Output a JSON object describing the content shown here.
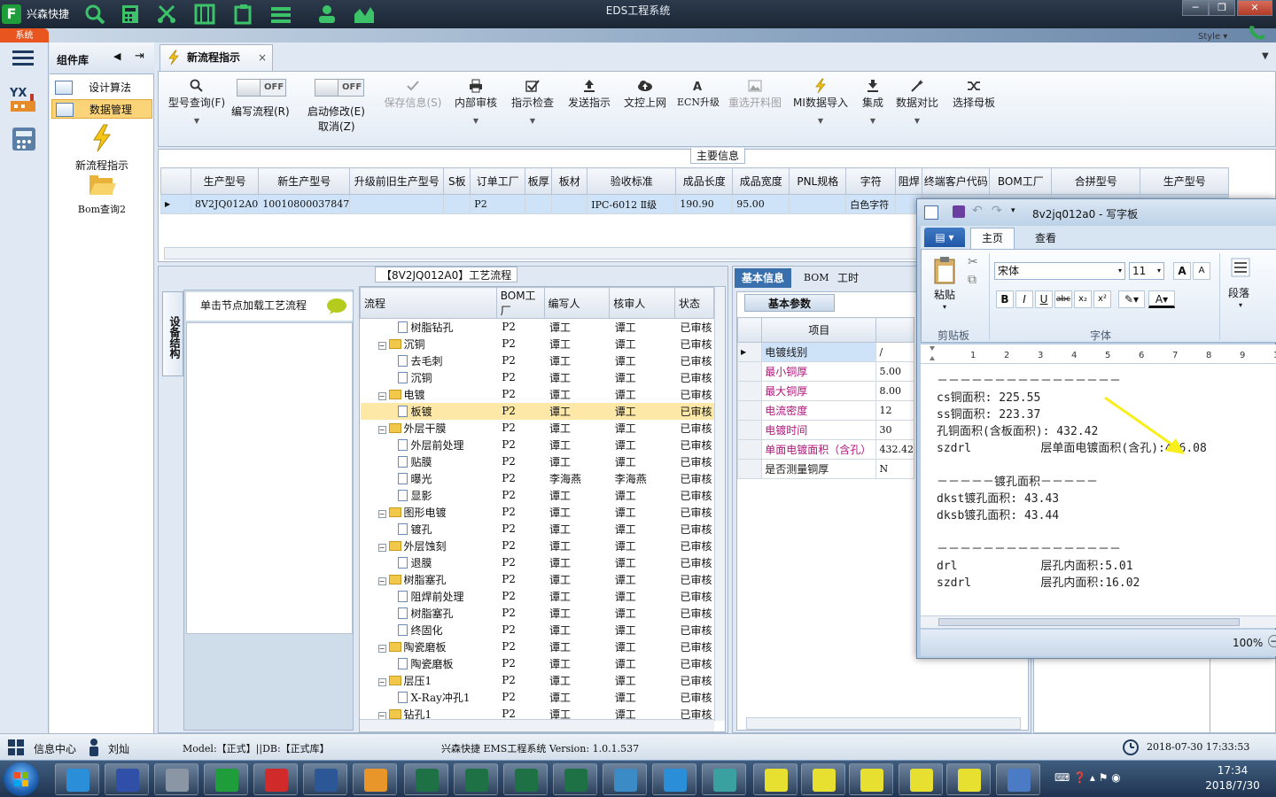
{
  "app": {
    "logo": "F",
    "name": "兴森快捷",
    "window_title": "EDS工程系统",
    "style_label": "Style",
    "system_tab": "系统"
  },
  "sidebar": {
    "header": "组件库",
    "items": [
      {
        "label": "设计算法"
      },
      {
        "label": "数据管理"
      }
    ],
    "big_items": [
      {
        "label": "新流程指示"
      },
      {
        "label": "Bom查询2"
      }
    ]
  },
  "doc_tab": {
    "label": "新流程指示"
  },
  "toolbar": {
    "buttons": [
      {
        "label": "型号查询(F)",
        "icon": "search-icon"
      },
      {
        "label": "保存信息(S)",
        "icon": "check-icon"
      },
      {
        "label": "内部审核",
        "icon": "printer-icon"
      },
      {
        "label": "指示检查",
        "icon": "checkbox-icon"
      },
      {
        "label": "发送指示",
        "icon": "upload-icon"
      },
      {
        "label": "文控上网",
        "icon": "cloud-upload-icon"
      },
      {
        "label": "ECN升级",
        "icon": "ecn-icon"
      },
      {
        "label": "重选开料图",
        "icon": "image-icon"
      },
      {
        "label": "MI数据导入",
        "icon": "lightning-icon"
      },
      {
        "label": "集成",
        "icon": "download-icon"
      },
      {
        "label": "数据对比",
        "icon": "wand-icon"
      },
      {
        "label": "选择母板",
        "icon": "shuffle-icon"
      }
    ],
    "toggle1": {
      "state": "OFF",
      "label": "编写流程(R)"
    },
    "toggle2": {
      "state": "OFF",
      "label": "启动修改(E)",
      "sub": "取消(Z)"
    }
  },
  "main_info": {
    "title": "主要信息",
    "columns": [
      "生产型号",
      "新生产型号",
      "升级前旧生产型号",
      "S板",
      "订单工厂",
      "板厚",
      "板材",
      "验收标准",
      "成品长度",
      "成品宽度",
      "PNL规格",
      "字符",
      "阻焊",
      "终端客户代码",
      "BOM工厂",
      "合拼型号",
      "生产型号"
    ],
    "row": [
      "8V2JQ012A0",
      "10010800037847",
      "",
      "",
      "P2",
      "",
      "",
      "IPC-6012 Ⅱ级",
      "190.90",
      "95.00",
      "",
      "白色字符",
      "",
      "",
      "",
      "",
      ""
    ]
  },
  "process": {
    "title": "【8V2JQ012A0】工艺流程",
    "side_tab": "设备结构",
    "hint": "单击节点加载工艺流程",
    "columns": [
      "流程",
      "BOM工厂",
      "编写人",
      "核审人",
      "状态"
    ],
    "rows": [
      {
        "name": "树脂钻孔",
        "level": 2,
        "bom": "P2",
        "writer": "谭工",
        "checker": "谭工",
        "status": "已审核"
      },
      {
        "name": "沉铜",
        "level": 1,
        "bom": "P2",
        "writer": "谭工",
        "checker": "谭工",
        "status": "已审核"
      },
      {
        "name": "去毛刺",
        "level": 2,
        "bom": "P2",
        "writer": "谭工",
        "checker": "谭工",
        "status": "已审核"
      },
      {
        "name": "沉铜",
        "level": 2,
        "bom": "P2",
        "writer": "谭工",
        "checker": "谭工",
        "status": "已审核"
      },
      {
        "name": "电镀",
        "level": 1,
        "bom": "P2",
        "writer": "谭工",
        "checker": "谭工",
        "status": "已审核"
      },
      {
        "name": "板镀",
        "level": 2,
        "bom": "P2",
        "writer": "谭工",
        "checker": "谭工",
        "status": "已审核",
        "selected": true
      },
      {
        "name": "外层干膜",
        "level": 1,
        "bom": "P2",
        "writer": "谭工",
        "checker": "谭工",
        "status": "已审核"
      },
      {
        "name": "外层前处理",
        "level": 2,
        "bom": "P2",
        "writer": "谭工",
        "checker": "谭工",
        "status": "已审核"
      },
      {
        "name": "贴膜",
        "level": 2,
        "bom": "P2",
        "writer": "谭工",
        "checker": "谭工",
        "status": "已审核"
      },
      {
        "name": "曝光",
        "level": 2,
        "bom": "P2",
        "writer": "李海燕",
        "checker": "李海燕",
        "status": "已审核"
      },
      {
        "name": "显影",
        "level": 2,
        "bom": "P2",
        "writer": "谭工",
        "checker": "谭工",
        "status": "已审核"
      },
      {
        "name": "图形电镀",
        "level": 1,
        "bom": "P2",
        "writer": "谭工",
        "checker": "谭工",
        "status": "已审核"
      },
      {
        "name": "镀孔",
        "level": 2,
        "bom": "P2",
        "writer": "谭工",
        "checker": "谭工",
        "status": "已审核"
      },
      {
        "name": "外层蚀刻",
        "level": 1,
        "bom": "P2",
        "writer": "谭工",
        "checker": "谭工",
        "status": "已审核"
      },
      {
        "name": "退膜",
        "level": 2,
        "bom": "P2",
        "writer": "谭工",
        "checker": "谭工",
        "status": "已审核"
      },
      {
        "name": "树脂塞孔",
        "level": 1,
        "bom": "P2",
        "writer": "谭工",
        "checker": "谭工",
        "status": "已审核"
      },
      {
        "name": "阻焊前处理",
        "level": 2,
        "bom": "P2",
        "writer": "谭工",
        "checker": "谭工",
        "status": "已审核"
      },
      {
        "name": "树脂塞孔",
        "level": 2,
        "bom": "P2",
        "writer": "谭工",
        "checker": "谭工",
        "status": "已审核"
      },
      {
        "name": "终固化",
        "level": 2,
        "bom": "P2",
        "writer": "谭工",
        "checker": "谭工",
        "status": "已审核"
      },
      {
        "name": "陶瓷磨板",
        "level": 1,
        "bom": "P2",
        "writer": "谭工",
        "checker": "谭工",
        "status": "已审核"
      },
      {
        "name": "陶瓷磨板",
        "level": 2,
        "bom": "P2",
        "writer": "谭工",
        "checker": "谭工",
        "status": "已审核"
      },
      {
        "name": "层压1",
        "level": 1,
        "bom": "P2",
        "writer": "谭工",
        "checker": "谭工",
        "status": "已审核"
      },
      {
        "name": "X-Ray冲孔1",
        "level": 2,
        "bom": "P2",
        "writer": "谭工",
        "checker": "谭工",
        "status": "已审核"
      },
      {
        "name": "钻孔1",
        "level": 1,
        "bom": "P2",
        "writer": "谭工",
        "checker": "谭工",
        "status": "已审核"
      }
    ]
  },
  "basic": {
    "tabs": [
      "基本信息",
      "BOM",
      "工时"
    ],
    "subtab": "基本参数",
    "col_item": "项目",
    "rows": [
      {
        "item": "电镀线别",
        "value": "/",
        "color": "#1a1a1a",
        "selected": true
      },
      {
        "item": "最小铜厚",
        "value": "5.00",
        "color": "#b0157a"
      },
      {
        "item": "最大铜厚",
        "value": "8.00",
        "color": "#b0157a"
      },
      {
        "item": "电流密度",
        "value": "12",
        "color": "#b0157a"
      },
      {
        "item": "电镀时间",
        "value": "30",
        "color": "#b0157a"
      },
      {
        "item": "单面电镀面积（含孔）",
        "value": "432.42",
        "color": "#b0157a"
      },
      {
        "item": "是否测量铜厚",
        "value": "N",
        "color": "#1a1a1a"
      }
    ]
  },
  "wordpad": {
    "title": "8v2jq012a0 - 写字板",
    "tabs": [
      "主页",
      "查看"
    ],
    "paste_label": "粘贴",
    "clipboard_label": "剪贴板",
    "font_group_label": "字体",
    "font_name": "宋体",
    "font_size": "11",
    "para_label": "段落",
    "zoom": "100%",
    "lines": [
      "－－－－－－－－－－－－－－－－",
      "cs铜面积: 225.55",
      "ss铜面积: 223.37",
      "孔铜面积(含板面积): 432.42",
      "szdrl          层单面电镀面积(含孔):446.08",
      "",
      "－－－－－镀孔面积－－－－－",
      "dkst镀孔面积: 43.43",
      "dksb镀孔面积: 43.44",
      "",
      "－－－－－－－－－－－－－－－－",
      "drl            层孔内面积:5.01",
      "szdrl          层孔内面积:16.02"
    ]
  },
  "status": {
    "info_center": "信息中心",
    "user": "刘灿",
    "model": "Model:【正式】||DB:【正式库】",
    "version": "兴森快捷 EMS工程系统 Version: 1.0.1.537",
    "datetime": "2018-07-30 17:33:53"
  },
  "taskbar": {
    "time": "17:34",
    "date": "2018/7/30"
  },
  "colors": {
    "accent": "#e8551e",
    "title_bar": "#1f2c3b",
    "selected_row": "#fde8a8",
    "highlight_label": "#b0157a"
  }
}
